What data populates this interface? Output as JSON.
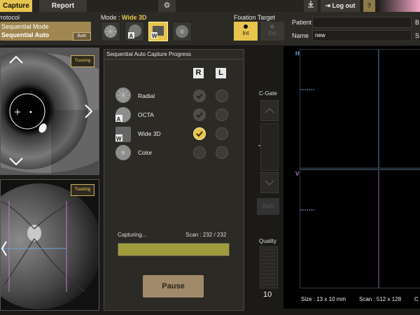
{
  "tabs": {
    "capture": "Capture",
    "report": "Report"
  },
  "header": {
    "logout_label": "Log out",
    "help_label": "?"
  },
  "protocol": {
    "title": "Protocol",
    "line1": "Sequential Mode",
    "line2": "Sequential Auto",
    "both_label": "Both"
  },
  "mode": {
    "title": "Mode :",
    "value": "Wide 3D"
  },
  "fixation": {
    "title": "Fixation Target",
    "int_label": "Int",
    "ext_label": "Ext"
  },
  "patient": {
    "id_label": "Patient ID",
    "id_value": "",
    "name_label": "Name",
    "name_value": "new",
    "extra1": "B",
    "extra2": "S"
  },
  "tracking": {
    "top": "Tracking",
    "bottom": "Tracking"
  },
  "panel": {
    "title": "Sequential Auto Capture Progress",
    "right_header": "R",
    "left_header": "L",
    "rows": [
      {
        "label": "Radial",
        "badge": ""
      },
      {
        "label": "OCTA",
        "badge": "A"
      },
      {
        "label": "Wide 3D",
        "badge": "W"
      },
      {
        "label": "Color",
        "badge": ""
      }
    ],
    "capturing_label": "Capturing...",
    "scan_label": "Scan :  232 / 232",
    "progress": 1.0,
    "pause_label": "Pause"
  },
  "cgate": {
    "label": "C-Gate",
    "auto_label": "Auto"
  },
  "quality": {
    "label": "Quality",
    "value": "10"
  },
  "scan": {
    "h_label": "H",
    "v_label": "V",
    "size": "Size : 13 x 10 mm",
    "scan_info": "Scan : 512 x 128",
    "c_partial": "C"
  },
  "colors": {
    "accent": "#e6c44e",
    "h_line": "#6ba7d8",
    "v_line": "#b97fd0"
  }
}
